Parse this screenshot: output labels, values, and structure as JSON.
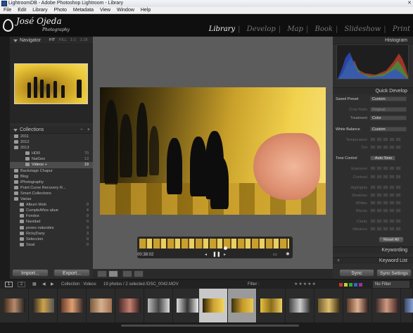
{
  "window": {
    "title": "LightroomDB - Adobe Photoshop Lightroom - Library"
  },
  "menu": [
    "File",
    "Edit",
    "Library",
    "Photo",
    "Metadata",
    "View",
    "Window",
    "Help"
  ],
  "identity": {
    "name": "José Ojeda",
    "tagline": "Photography"
  },
  "modules": [
    {
      "label": "Library",
      "active": true
    },
    {
      "label": "Develop",
      "active": false
    },
    {
      "label": "Map",
      "active": false
    },
    {
      "label": "Book",
      "active": false
    },
    {
      "label": "Slideshow",
      "active": false
    },
    {
      "label": "Print",
      "active": false
    }
  ],
  "navigator": {
    "title": "Navigator",
    "zoom_options": [
      "FIT",
      "FILL",
      "1:1",
      "1:16"
    ]
  },
  "collections": {
    "title": "Collections",
    "items": [
      {
        "label": "2011",
        "count": ""
      },
      {
        "label": "2012",
        "count": ""
      },
      {
        "label": "2013",
        "count": ""
      },
      {
        "label": "HDR",
        "count": "70"
      },
      {
        "label": "NatGeo",
        "count": "13"
      },
      {
        "label": "Videos +",
        "count": "19"
      },
      {
        "label": "Backstage Chapur",
        "count": ""
      },
      {
        "label": "Blog",
        "count": ""
      },
      {
        "label": "iPhotography",
        "count": ""
      },
      {
        "label": "Point Curve Recovery R...",
        "count": ""
      },
      {
        "label": "Smart Collections",
        "count": ""
      },
      {
        "label": "Varias",
        "count": ""
      },
      {
        "label": "Album Web",
        "count": "0"
      },
      {
        "label": "CumpleAños abue",
        "count": "4"
      },
      {
        "label": "Fondos",
        "count": "0"
      },
      {
        "label": "Navidad",
        "count": "0"
      },
      {
        "label": "poses naturales",
        "count": "0"
      },
      {
        "label": "RickyDany",
        "count": "3"
      },
      {
        "label": "Seleccion",
        "count": "0"
      },
      {
        "label": "Sisal",
        "count": "0"
      }
    ]
  },
  "left_buttons": {
    "import": "Import...",
    "export": "Export..."
  },
  "video": {
    "timecode": "00:38:02"
  },
  "histogram": {
    "title": "Histogram"
  },
  "quick_develop": {
    "title": "Quick Develop",
    "saved_preset": {
      "label": "Saved Preset",
      "value": "Custom"
    },
    "crop_ratio": {
      "label": "Crop Ratio",
      "value": "Original"
    },
    "treatment": {
      "label": "Treatment",
      "value": "Color"
    },
    "white_balance": {
      "label": "White Balance",
      "value": "Custom"
    },
    "temperature": "Temperature",
    "tint": "Tint",
    "tone_control": {
      "label": "Tone Control",
      "button": "Auto Tone"
    },
    "sliders": [
      "Exposure",
      "Contrast",
      "Highlights",
      "Shadows",
      "Whites",
      "Blacks",
      "Clarity",
      "Vibrance"
    ],
    "reset": "Reset All"
  },
  "keywording": "Keywording",
  "keyword_list": "Keyword List",
  "sync": {
    "sync": "Sync",
    "sync_settings": "Sync Settings"
  },
  "filmbar": {
    "pages": [
      "1",
      "2"
    ],
    "source": "Collection : Videos",
    "info": "19 photos / 2 selected /DSC_0042.MOV",
    "filter_label": "Filter :",
    "filter_value": "No Filter"
  },
  "colors": {
    "accent": "#f2f2f2",
    "panel": "#2e2e2e",
    "background": "#1b1b1b"
  }
}
